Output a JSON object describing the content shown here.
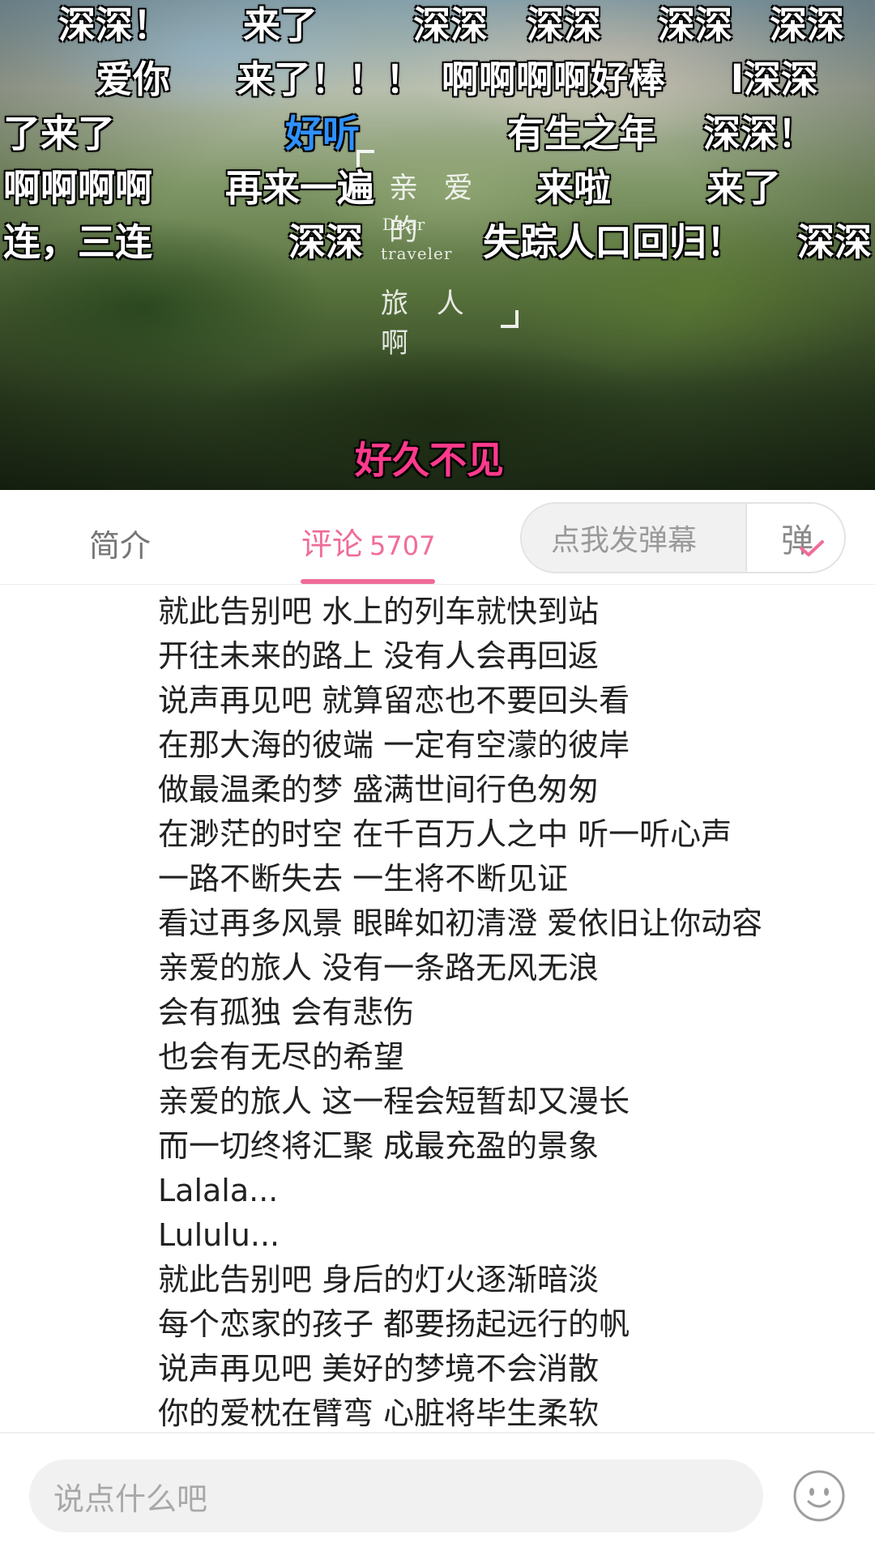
{
  "video": {
    "title_card": {
      "top": "亲 爱 的",
      "mid1": "Dear",
      "mid2": "traveler",
      "bottom": "旅 人 啊"
    },
    "danmaku_row1": [
      "深深！",
      "来了",
      "深深",
      "深深",
      "深深",
      "深深"
    ],
    "danmaku_row2": [
      "爱你",
      "来了！！！",
      "啊啊啊啊好棒",
      "l深深"
    ],
    "danmaku_row3": [
      "了来了",
      "好听",
      "有生之年",
      "深深！"
    ],
    "danmaku_row4": [
      "啊啊啊啊",
      "再来一遍",
      "来啦",
      "来了"
    ],
    "danmaku_row5": [
      "连，三连",
      "深深",
      "失踪人口回归！",
      "深深"
    ],
    "danmaku_bottom": "好久不见",
    "danmaku_colors": {
      "default": "#ffffff",
      "blue": "#2f90ff",
      "pink": "#ff3a8c"
    }
  },
  "tabs": {
    "intro_label": "简介",
    "comments_label": "评论",
    "comments_count": "5707",
    "active_color": "#f06c99"
  },
  "danmaku_send": {
    "placeholder": "点我发弹幕",
    "toggle_label": "弹"
  },
  "lyrics": [
    "就此告别吧 水上的列车就快到站",
    "开往未来的路上 没有人会再回返",
    "说声再见吧 就算留恋也不要回头看",
    "在那大海的彼端 一定有空濛的彼岸",
    "做最温柔的梦 盛满世间行色匆匆",
    "在渺茫的时空 在千百万人之中 听一听心声",
    "一路不断失去 一生将不断见证",
    "看过再多风景 眼眸如初清澄 爱依旧让你动容",
    "亲爱的旅人 没有一条路无风无浪",
    "会有孤独 会有悲伤",
    "也会有无尽的希望",
    "亲爱的旅人 这一程会短暂却又漫长",
    "而一切终将汇聚 成最充盈的景象",
    "Lalala...",
    "Lululu...",
    "就此告别吧 身后的灯火逐渐暗淡",
    "每个恋家的孩子 都要扬起远行的帆",
    "说声再见吧 美好的梦境不会消散",
    "你的爱枕在臂弯 心脏将毕生柔软"
  ],
  "comment_bar": {
    "placeholder": "说点什么吧",
    "emoji_icon": "smiley-face-icon"
  }
}
